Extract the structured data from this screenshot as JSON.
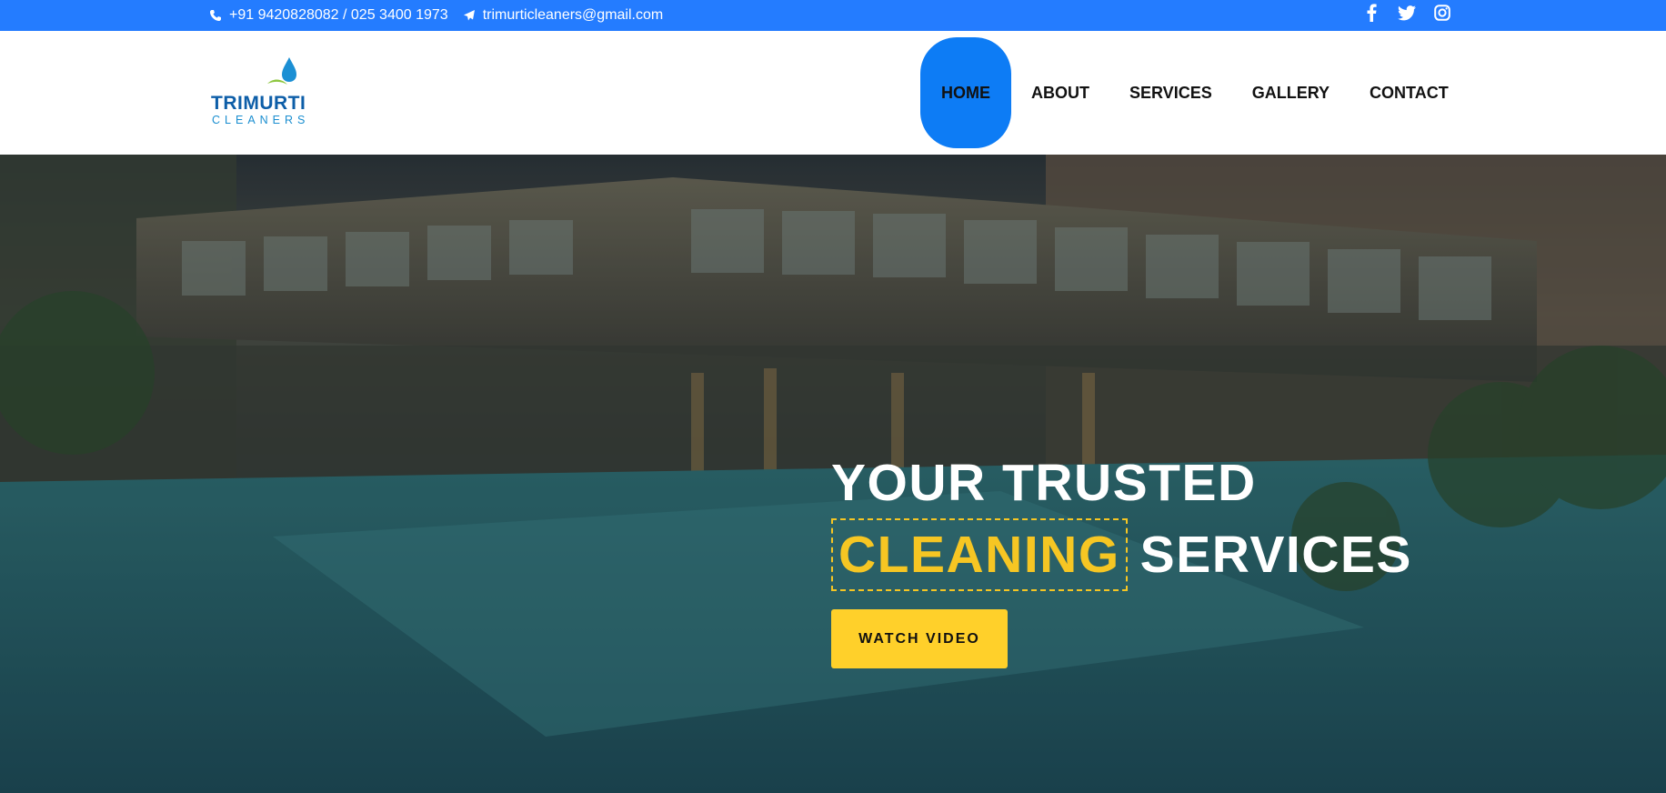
{
  "topbar": {
    "phone": "+91 9420828082 / 025 3400 1973",
    "email": "trimurticleaners@gmail.com",
    "social": [
      "facebook-icon",
      "twitter-icon",
      "instagram-icon"
    ],
    "bg_color": "#247cff"
  },
  "logo": {
    "brand": "TRIMURTI",
    "sub": "CLEANERS"
  },
  "nav": {
    "items": [
      "HOME",
      "ABOUT",
      "SERVICES",
      "GALLERY",
      "CONTACT"
    ],
    "active": "HOME",
    "active_color": "#0d7cf5"
  },
  "hero": {
    "line1": "YOUR TRUSTED",
    "highlight": "CLEANING",
    "line2_rest": "SERVICES",
    "button": "WATCH VIDEO",
    "accent_color": "#f6c623"
  }
}
